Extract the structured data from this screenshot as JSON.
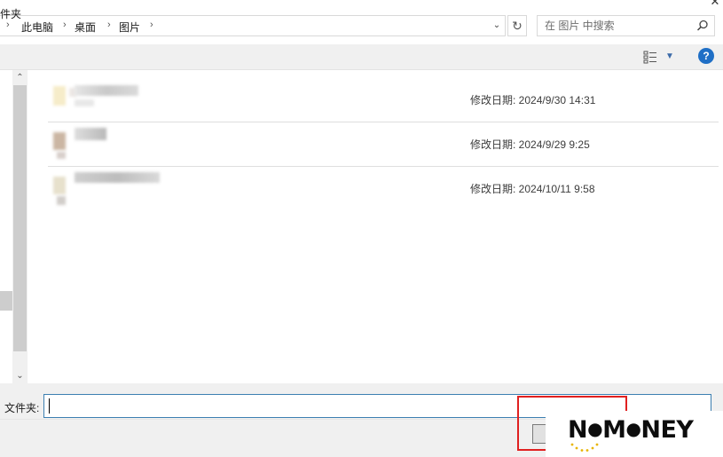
{
  "address_bar": {
    "breadcrumbs": [
      {
        "label": "此电脑"
      },
      {
        "label": "桌面"
      },
      {
        "label": "图片"
      }
    ]
  },
  "search": {
    "placeholder": "在 图片 中搜索"
  },
  "toolbar": {
    "label": "件夹"
  },
  "files": [
    {
      "date": "修改日期: 2024/9/30 14:31"
    },
    {
      "date": "修改日期: 2024/9/29 9:25"
    },
    {
      "date": "修改日期: 2024/10/11 9:58"
    }
  ],
  "folder_field": {
    "label": "文件夹:",
    "value": ""
  },
  "help_label": "?",
  "watermark": {
    "text": "NOMONEY"
  },
  "colors": {
    "accent": "#1f6fc6",
    "highlight": "#e02020",
    "input_border": "#3c7fb1"
  }
}
